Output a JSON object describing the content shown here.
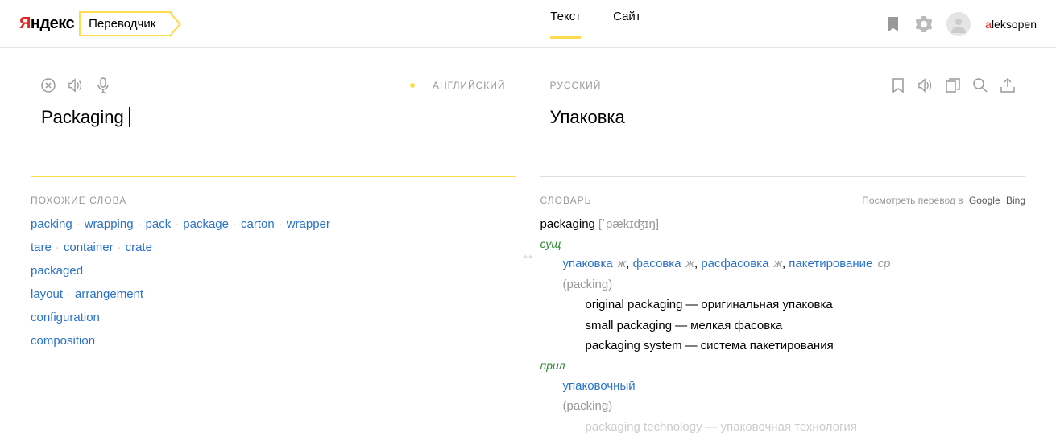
{
  "header": {
    "logo_prefix": "Я",
    "logo_rest": "ндекс",
    "service": "Переводчик",
    "tabs": [
      "Текст",
      "Сайт"
    ],
    "active_tab": 0,
    "username_first": "a",
    "username_rest": "leksopen"
  },
  "source": {
    "lang": "АНГЛИЙСКИЙ",
    "text": "Packaging"
  },
  "target": {
    "lang": "РУССКИЙ",
    "text": "Упаковка"
  },
  "similar": {
    "title": "ПОХОЖИЕ СЛОВА",
    "rows": [
      [
        "packing",
        "wrapping",
        "pack",
        "package",
        "carton",
        "wrapper"
      ],
      [
        "tare",
        "container",
        "crate"
      ],
      [
        "packaged"
      ],
      [
        "layout",
        "arrangement"
      ],
      [
        "configuration"
      ],
      [
        "composition"
      ]
    ]
  },
  "dict": {
    "title": "СЛОВАРЬ",
    "ext_prefix": "Посмотреть перевод в",
    "ext_links": [
      "Google",
      "Bing"
    ],
    "headword": "packaging",
    "ipa": "[ˈpækɪʤɪŋ]",
    "pos1": "сущ",
    "senses1": [
      {
        "tr": "упаковка",
        "g": "ж"
      },
      {
        "tr": "фасовка",
        "g": "ж"
      },
      {
        "tr": "расфасовка",
        "g": "ж"
      },
      {
        "tr": "пакетирование",
        "g": "ср"
      }
    ],
    "syn1": "(packing)",
    "examples1": [
      {
        "en": "original packaging",
        "ru": "оригинальная упаковка"
      },
      {
        "en": "small packaging",
        "ru": "мелкая фасовка"
      },
      {
        "en": "packaging system",
        "ru": "система пакетирования"
      }
    ],
    "pos2": "прил",
    "senses2": [
      {
        "tr": "упаковочный",
        "g": ""
      }
    ],
    "syn2": "(packing)",
    "examples2": [
      {
        "en": "packaging technology",
        "ru": "упаковочная технология"
      }
    ]
  }
}
